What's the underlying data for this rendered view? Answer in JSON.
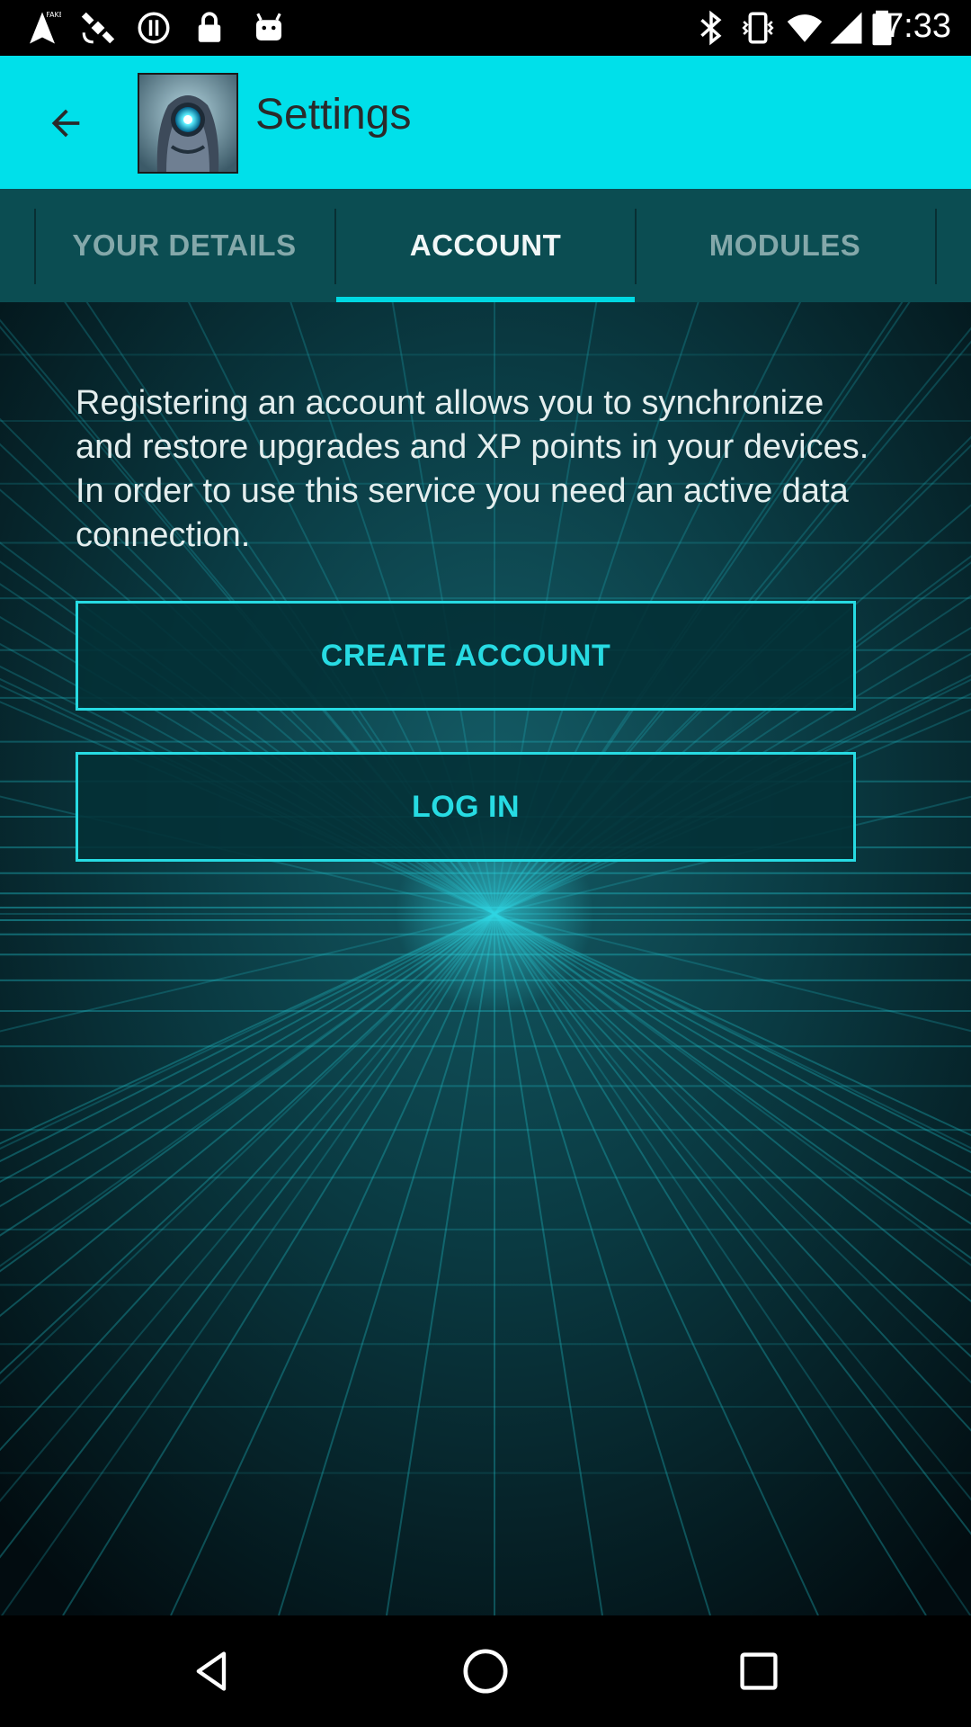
{
  "status_bar": {
    "time": "7:33",
    "left_icons": [
      "fake-gps-icon",
      "satellite-icon",
      "sync-disabled-icon",
      "lock-icon",
      "android-icon"
    ],
    "right_icons": [
      "bluetooth-icon",
      "vibrate-icon",
      "wifi-icon",
      "signal-icon",
      "battery-icon"
    ]
  },
  "app_bar": {
    "title": "Settings",
    "back_icon": "arrow-back-icon",
    "logo_icon": "robot-avatar-icon",
    "background_color": "#00e0ea"
  },
  "tabs": [
    {
      "label": "YOUR DETAILS",
      "selected": false
    },
    {
      "label": "ACCOUNT",
      "selected": true
    },
    {
      "label": "MODULES",
      "selected": false
    }
  ],
  "content": {
    "description": "Registering an account allows you to synchronize and restore upgrades and XP points in your devices. In order to use this service you need an active data connection.",
    "create_account_label": "CREATE ACCOUNT",
    "login_label": "LOG IN",
    "accent_color": "#27dbe3"
  },
  "nav_bar": {
    "buttons": [
      "back-triangle-icon",
      "home-circle-icon",
      "recents-square-icon"
    ]
  }
}
